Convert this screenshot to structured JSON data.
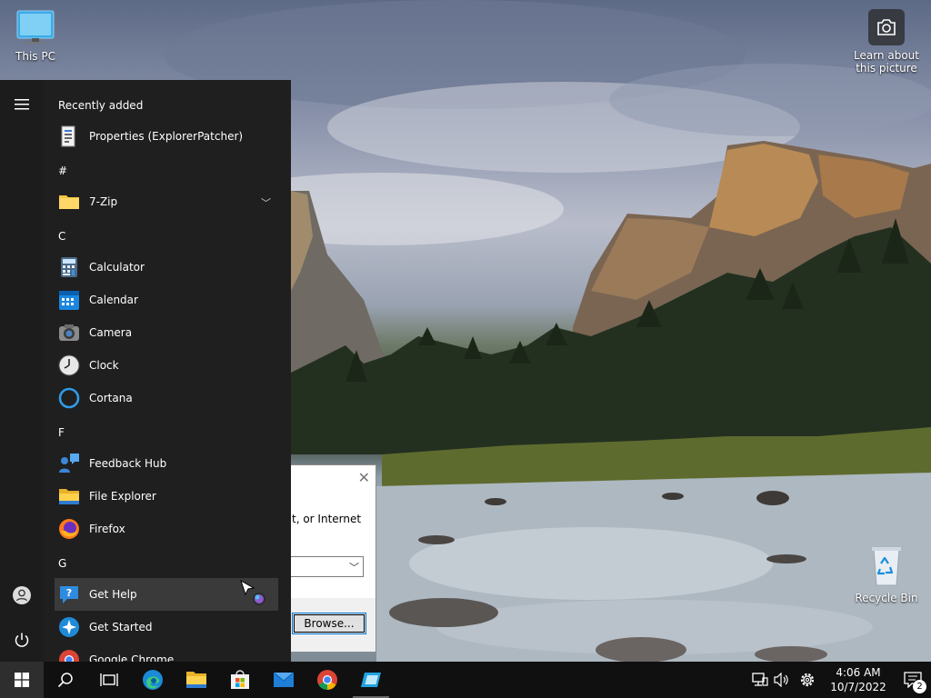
{
  "desktop": {
    "this_pc_label": "This PC",
    "recycle_bin_label": "Recycle Bin",
    "learn_picture_label_line1": "Learn about",
    "learn_picture_label_line2": "this picture"
  },
  "run_dialog": {
    "description_fragment": "t, or Internet",
    "browse_label": "Browse..."
  },
  "start_menu": {
    "recently_added_header": "Recently added",
    "recently_added": [
      {
        "label": "Properties (ExplorerPatcher)",
        "icon": "properties-icon"
      }
    ],
    "sections": [
      {
        "header": "#",
        "apps": [
          {
            "label": "7-Zip",
            "icon": "folder-icon",
            "expandable": true
          }
        ]
      },
      {
        "header": "C",
        "apps": [
          {
            "label": "Calculator",
            "icon": "calculator-icon"
          },
          {
            "label": "Calendar",
            "icon": "calendar-icon"
          },
          {
            "label": "Camera",
            "icon": "camera-icon"
          },
          {
            "label": "Clock",
            "icon": "clock-icon"
          },
          {
            "label": "Cortana",
            "icon": "cortana-icon"
          }
        ]
      },
      {
        "header": "F",
        "apps": [
          {
            "label": "Feedback Hub",
            "icon": "feedback-hub-icon"
          },
          {
            "label": "File Explorer",
            "icon": "file-explorer-icon"
          },
          {
            "label": "Firefox",
            "icon": "firefox-icon"
          }
        ]
      },
      {
        "header": "G",
        "apps": [
          {
            "label": "Get Help",
            "icon": "get-help-icon",
            "hovered": true
          },
          {
            "label": "Get Started",
            "icon": "get-started-icon"
          },
          {
            "label": "Google Chrome",
            "icon": "chrome-icon"
          }
        ]
      }
    ]
  },
  "taskbar": {
    "pinned": [
      "start-icon",
      "search-icon",
      "task-view-icon",
      "edge-icon",
      "file-explorer-icon",
      "store-icon",
      "mail-icon",
      "chrome-icon",
      "run-app-icon"
    ],
    "clock_time": "4:06 AM",
    "clock_date": "10/7/2022",
    "notification_count": "2"
  },
  "colors": {
    "start_bg": "#1f1f1f",
    "taskbar_bg": "#101010",
    "accent": "#0078d7"
  }
}
